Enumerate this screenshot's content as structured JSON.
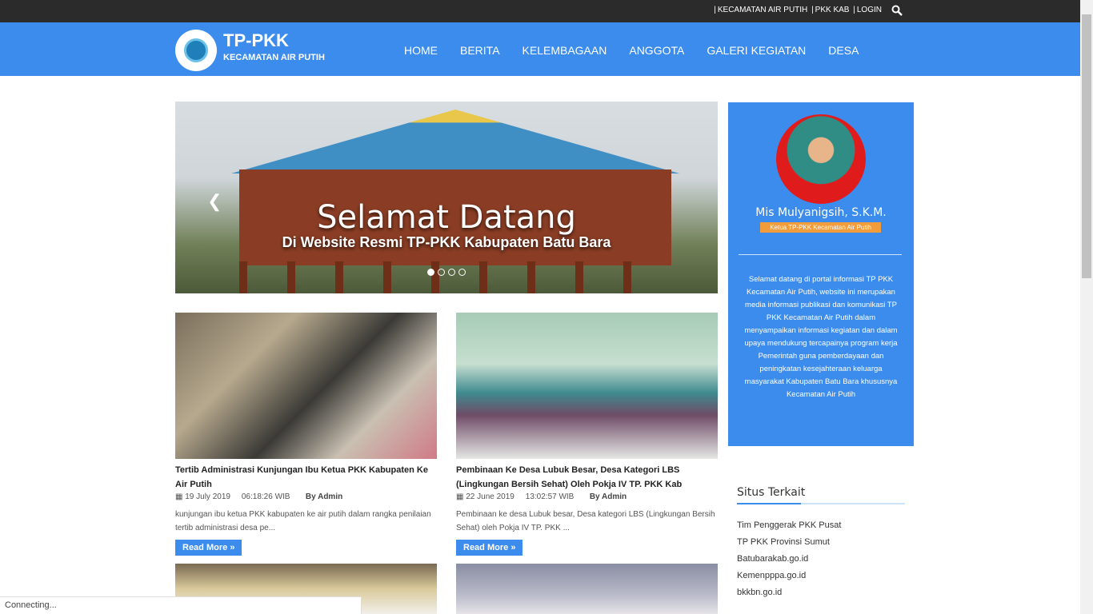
{
  "topbar": {
    "links": [
      "KECAMATAN AIR PUTIH",
      "PKK KAB",
      "LOGIN"
    ]
  },
  "brand": {
    "title": "TP-PKK",
    "subtitle": "KECAMATAN AIR PUTIH"
  },
  "nav": {
    "items": [
      "HOME",
      "BERITA",
      "KELEMBAGAAN",
      "ANGGOTA",
      "GALERI KEGIATAN",
      "DESA"
    ]
  },
  "slider": {
    "title": "Selamat Datang",
    "subtitle": "Di Website Resmi TP-PKK Kabupaten Batu Bara",
    "slide_count": 4,
    "active_index": 0
  },
  "posts": [
    {
      "title": "Tertib Administrasi Kunjungan Ibu Ketua PKK Kabupaten Ke Air Putih",
      "date": "19 July 2019",
      "time": "06:18:26 WIB",
      "author": "By Admin",
      "excerpt": "kunjungan ibu ketua PKK kabupaten ke air putih dalam rangka penilaian tertib administrasi desa pe...",
      "read_more": "Read More"
    },
    {
      "title": "Pembinaan Ke Desa Lubuk Besar, Desa Kategori LBS (Lingkungan Bersih Sehat) Oleh Pokja IV TP. PKK Kab",
      "date": "22 June 2019",
      "time": "13:02:57 WIB",
      "author": "By Admin",
      "excerpt": "Pembinaan ke desa Lubuk besar, Desa kategori LBS (Lingkungan Bersih Sehat) oleh Pokja IV TP. PKK ...",
      "read_more": "Read More"
    }
  ],
  "profile": {
    "name": "Mis Mulyanigsih, S.K.M.",
    "role": "Ketua TP-PKK Kecamatan Air Putih",
    "description": "Selamat datang di portal informasi TP PKK Kecamatan Air Putih, website ini merupakan media informasi publikasi dan komunikasi TP PKK Kecamatan Air Putih dalam menyampaikan informasi kegiatan dan dalam upaya mendukung tercapainya program kerja Pemerintah guna pemberdayaan dan peningkatan kesejahteraan keluarga masyarakat Kabupaten Batu Bara khususnya Kecamatan Air Putih"
  },
  "related": {
    "title": "Situs Terkait",
    "links": [
      "Tim Penggerak PKK Pusat",
      "TP PKK Provinsi Sumut",
      "Batubarakab.go.id",
      "Kemenpppa.go.id",
      "bkkbn.go.id"
    ]
  },
  "status_bar": {
    "text": "Connecting..."
  },
  "colors": {
    "primary": "#3b8ced",
    "topbar": "#2b2b2b",
    "badge": "#f39c3c"
  }
}
